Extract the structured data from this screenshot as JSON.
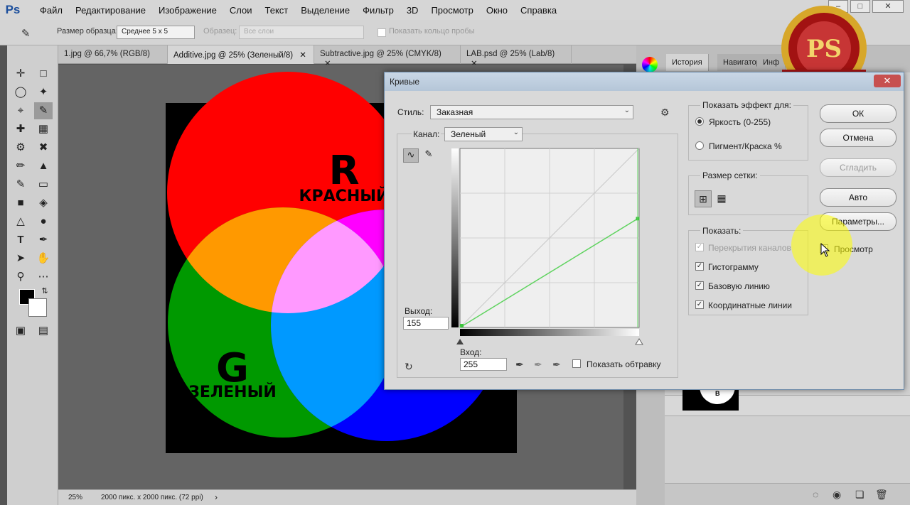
{
  "app": {
    "logo": "Ps",
    "menu": [
      "Файл",
      "Редактирование",
      "Изображение",
      "Слои",
      "Текст",
      "Выделение",
      "Фильтр",
      "3D",
      "Просмотр",
      "Окно",
      "Справка"
    ],
    "window_controls": [
      "–",
      "□",
      "✕"
    ]
  },
  "options": {
    "sample_size_label": "Размер образца:",
    "sample_size_value": "Среднее 5 x 5",
    "sample_label": "Образец:",
    "sample_value": "Все слои",
    "show_ring": "Показать кольцо пробы"
  },
  "tabs": [
    "1.jpg @ 66,7% (RGB/8)",
    "Additive.jpg @ 25% (Зеленый/8)",
    "Subtractive.jpg @ 25% (CMYK/8)",
    "LAB.psd @ 25% (Lab/8)"
  ],
  "tab_close": "✕",
  "status": {
    "zoom": "25%",
    "doc": "2000 пикс. x 2000 пикс. (72 ppi)",
    "arrow": "›"
  },
  "canvas_labels": {
    "r_letter": "R",
    "r_word": "КРАСНЫЙ",
    "g_letter": "G",
    "g_word": "ЗЕЛЕНЫЙ"
  },
  "panel": {
    "tabs": [
      "История",
      "Навигатор",
      "Инф"
    ],
    "thumb_text": "В"
  },
  "watermark": "PS",
  "dialog": {
    "title": "Кривые",
    "close": "✕",
    "style_label": "Стиль:",
    "style_value": "Заказная",
    "channel_label": "Канал:",
    "channel_value": "Зеленый",
    "output_label": "Выход:",
    "output_value": "155",
    "input_label": "Вход:",
    "input_value": "255",
    "show_clipping": "Показать обтравку",
    "show_effect_label": "Показать эффект для:",
    "radio_brightness": "Яркость (0-255)",
    "radio_pigment": "Пигмент/Краска %",
    "grid_size_label": "Размер сетки:",
    "show_label": "Показать:",
    "cb_overlays": "Перекрытия каналов",
    "cb_histogram": "Гистограмму",
    "cb_baseline": "Базовую линию",
    "cb_intersection": "Координатные линии",
    "buttons": {
      "ok": "ОК",
      "cancel": "Отмена",
      "smooth": "Сгладить",
      "auto": "Авто",
      "options": "Параметры..."
    },
    "preview": "Просмотр",
    "curve": {
      "input_end": 255,
      "output_end": 155,
      "input_start": 0,
      "output_start": 0,
      "color": "#5fd35f"
    }
  }
}
